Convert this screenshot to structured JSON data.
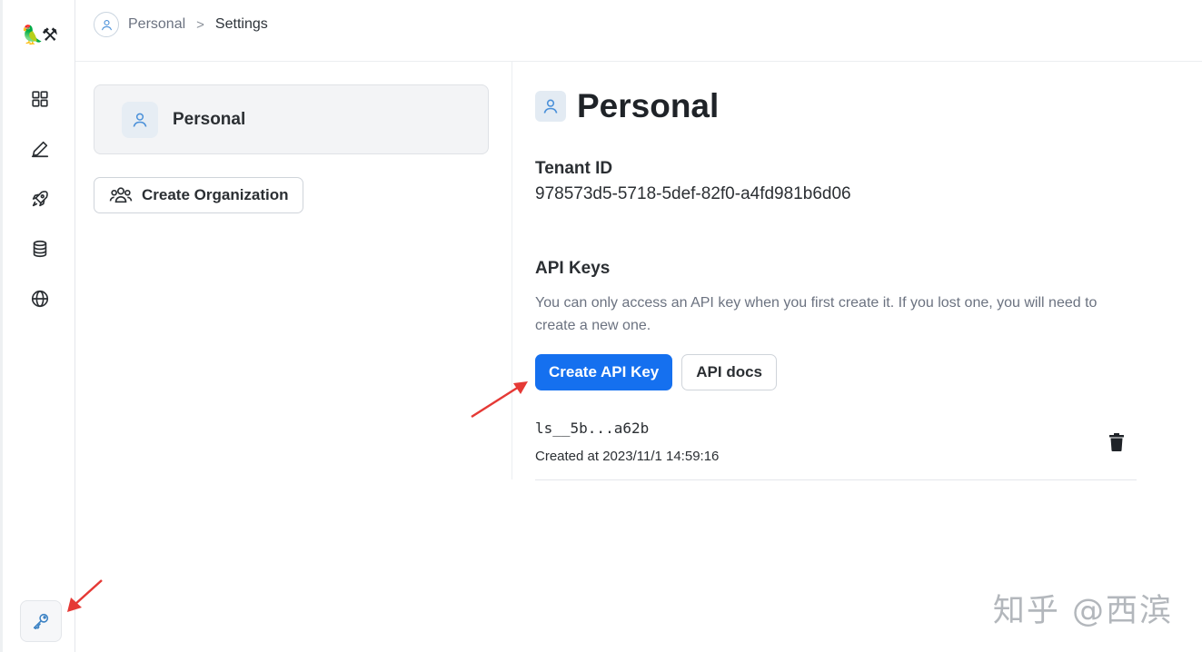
{
  "app": {
    "logo": "🦜⚒"
  },
  "breadcrumb": {
    "workspace": "Personal",
    "page": "Settings"
  },
  "tenant_list": {
    "current": "Personal",
    "create_org_label": "Create Organization"
  },
  "main": {
    "title": "Personal",
    "tenant_id_label": "Tenant ID",
    "tenant_id": "978573d5-5718-5def-82f0-a4fd981b6d06",
    "api_keys_label": "API Keys",
    "api_keys_desc": "You can only access an API key when you first create it. If you lost one, you will need to create a new one.",
    "create_key_label": "Create API Key",
    "docs_label": "API docs",
    "keys": [
      {
        "name": "ls__5b...a62b",
        "created": "Created at 2023/11/1 14:59:16"
      }
    ]
  },
  "watermark": "知乎 @西滨",
  "colors": {
    "primary": "#1570ef",
    "arrow": "#e53935",
    "accent_icon": "#4a90d9"
  },
  "icons": [
    "grid-icon",
    "pen-icon",
    "rocket-icon",
    "database-icon",
    "globe-icon",
    "key-icon",
    "user-icon",
    "users-icon",
    "trash-icon"
  ]
}
